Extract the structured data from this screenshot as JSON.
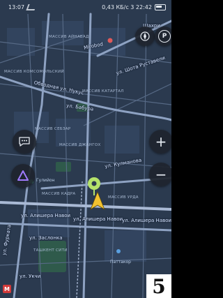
{
  "status_bar": {
    "time": "13:07",
    "right_text": "0,43 КБ/с  3 22:42"
  },
  "map": {
    "road_labels": [
      "Шахри",
      "Mirobod",
      "ул. Шота Руставели",
      "Обводная ул. Нукус",
      "ул. Бабура",
      "ул. Кулманова",
      "ул. Алишера Навои",
      "ул. Алишера Навои",
      "ул. Алишера Навои",
      "ул. Заслонка",
      "ул. Фурката",
      "ул. Укчи"
    ],
    "districts": [
      "МАССИВ АЙНАБАД",
      "МАССИВ КАТАРТАЛ",
      "МАССИВ КОМСОМОЛЬСКИЙ",
      "МАССИВ СЕБЗАР",
      "МАССИВ ДЖАНГОХ",
      "МАССИВ КАДРА",
      "МАССИВ УРДА",
      "ТАШКЕНТ СИТИ"
    ],
    "pois": [
      "Гулийон",
      "Паттакор"
    ]
  },
  "controls": {
    "compass_icon": "compass-icon",
    "parking_label": "P",
    "zoom_in_label": "+",
    "zoom_out_label": "−",
    "chat_icon": "chat-icon",
    "alice_icon": "assistant-triangle-icon",
    "metro_label": "M"
  },
  "page_number": "5",
  "colors": {
    "map_bg": "#2b3a4f",
    "road": "#7f93b3",
    "park": "#2f5a4b",
    "accent_yellow": "#f2c230",
    "accent_green": "#b4e26a",
    "alice_purple": "#a07bff"
  }
}
